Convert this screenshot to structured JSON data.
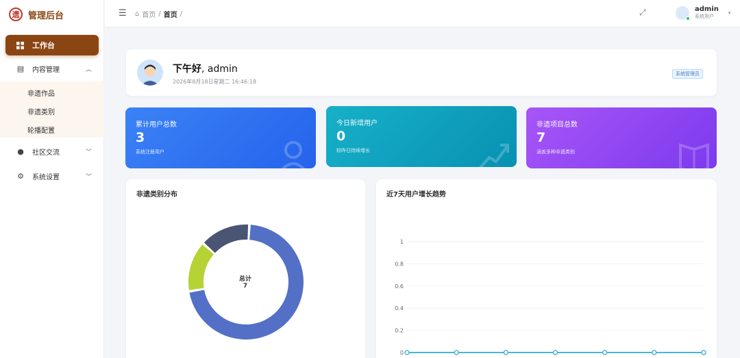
{
  "brand": {
    "title": "管理后台",
    "logo_glyph": "遗"
  },
  "sidebar": {
    "active": {
      "label": "工作台",
      "icon": "grid-icon"
    },
    "groups": [
      {
        "label": "内容管理",
        "icon": "document-icon",
        "expanded": true,
        "children": [
          "非遗作品",
          "非遗类别",
          "轮播配置"
        ]
      },
      {
        "label": "社区交流",
        "icon": "chat-icon",
        "expanded": false
      },
      {
        "label": "系统设置",
        "icon": "gear-icon",
        "expanded": false
      }
    ]
  },
  "topbar": {
    "breadcrumb": {
      "home": "首页",
      "sep": "/",
      "current": "首页"
    },
    "user": {
      "name": "admin",
      "role": "系统用户"
    }
  },
  "welcome": {
    "greeting": "下午好",
    "name": ", admin",
    "datetime": "2026年8月18日星期二 16:46:18",
    "role_tag": "系统管理员"
  },
  "stats": [
    {
      "label": "累计用户总数",
      "value": "3",
      "desc": "系统注册用户",
      "color": "#2563eb",
      "icon": "user-icon"
    },
    {
      "label": "今日新增用户",
      "value": "0",
      "desc": "较昨日持续增长",
      "color": "#0891b2",
      "icon": "trend-icon"
    },
    {
      "label": "非遗项目总数",
      "value": "7",
      "desc": "涵盖多种非遗类别",
      "color": "#7c3aed",
      "icon": "book-icon"
    }
  ],
  "panels": {
    "donut_title": "非遗类别分布",
    "donut_center_label": "总计",
    "donut_center_value": "7",
    "line_title": "近7天用户增长趋势"
  },
  "chart_data": [
    {
      "type": "pie",
      "title": "非遗类别分布",
      "donut": true,
      "values": [
        5,
        1,
        1
      ],
      "colors": [
        "#5470c6",
        "#b5d335",
        "#4a5573"
      ]
    },
    {
      "type": "line",
      "title": "近7天用户增长趋势",
      "yticks": [
        "0",
        "0.2",
        "0.4",
        "0.6",
        "0.8",
        "1"
      ],
      "ylim": [
        0,
        1
      ],
      "values": [
        0,
        0,
        0,
        0,
        0,
        0,
        0
      ],
      "color": "#4ab5d8"
    }
  ]
}
